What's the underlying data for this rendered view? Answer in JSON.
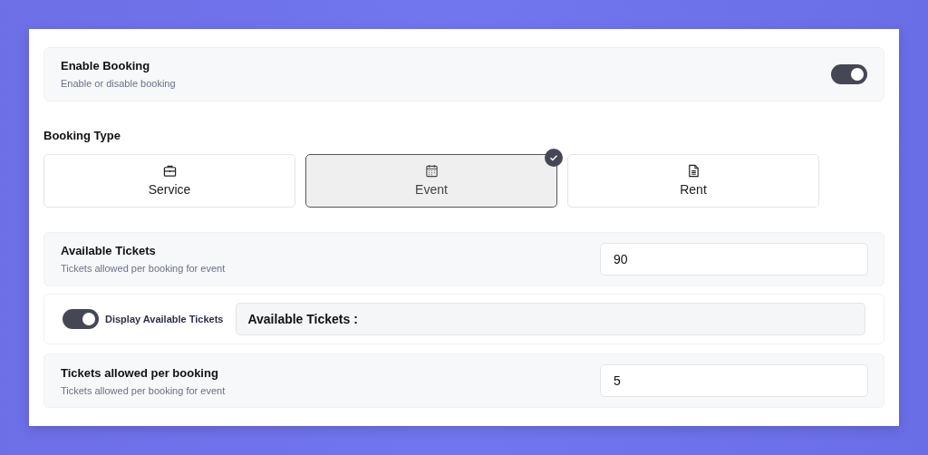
{
  "enable_booking": {
    "title": "Enable Booking",
    "description": "Enable or disable booking",
    "on": true
  },
  "booking_type": {
    "label": "Booking Type",
    "options": [
      {
        "kind": "briefcase",
        "label": "Service",
        "selected": false
      },
      {
        "kind": "calendar",
        "label": "Event",
        "selected": true
      },
      {
        "kind": "document",
        "label": "Rent",
        "selected": false
      }
    ]
  },
  "available_tickets": {
    "title": "Available Tickets",
    "description": "Tickets allowed per booking for event",
    "value": "90"
  },
  "display_available_tickets": {
    "label": "Display Available Tickets",
    "on": true,
    "value": "Available Tickets :"
  },
  "tickets_per_booking": {
    "title": "Tickets allowed per booking",
    "description": "Tickets allowed per booking for event",
    "value": "5"
  }
}
